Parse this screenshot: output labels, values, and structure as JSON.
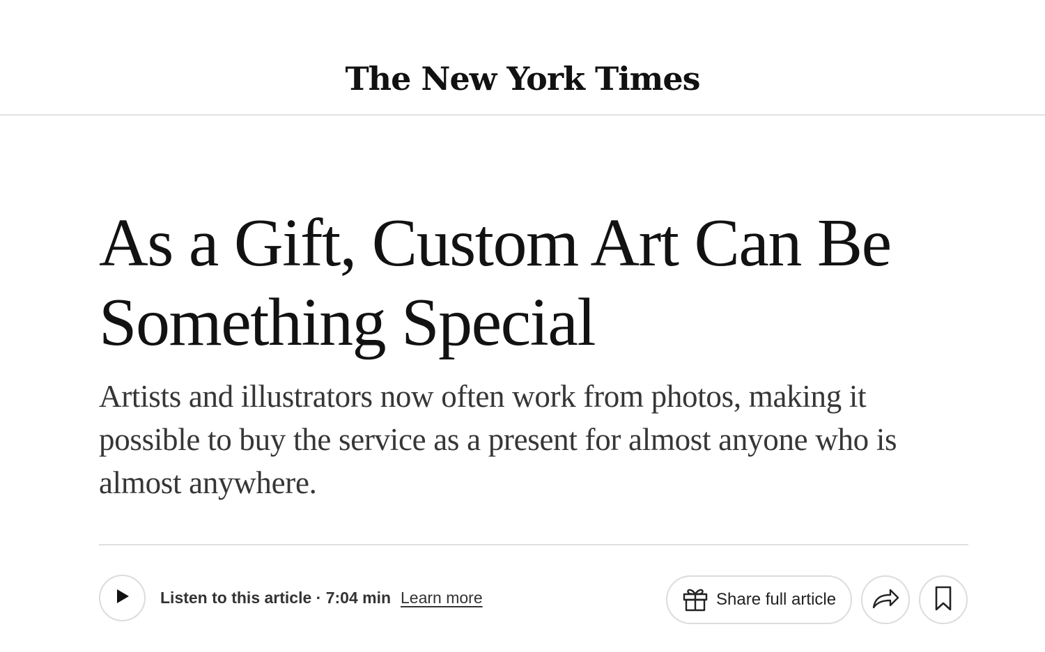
{
  "masthead": {
    "logo_text": "The New York Times"
  },
  "article": {
    "headline": "As a Gift, Custom Art Can Be Something Special",
    "summary": "Artists and illustrators now often work from photos, making it possible to buy the service as a present for almost anyone who is almost anywhere."
  },
  "toolbar": {
    "play_icon": "play-icon",
    "listen_label": "Listen to this article · 7:04 min",
    "learn_more_label": "Learn more",
    "share_icon": "gift-icon",
    "share_label": "Share full article",
    "forward_icon": "share-arrow-icon",
    "bookmark_icon": "bookmark-icon"
  }
}
